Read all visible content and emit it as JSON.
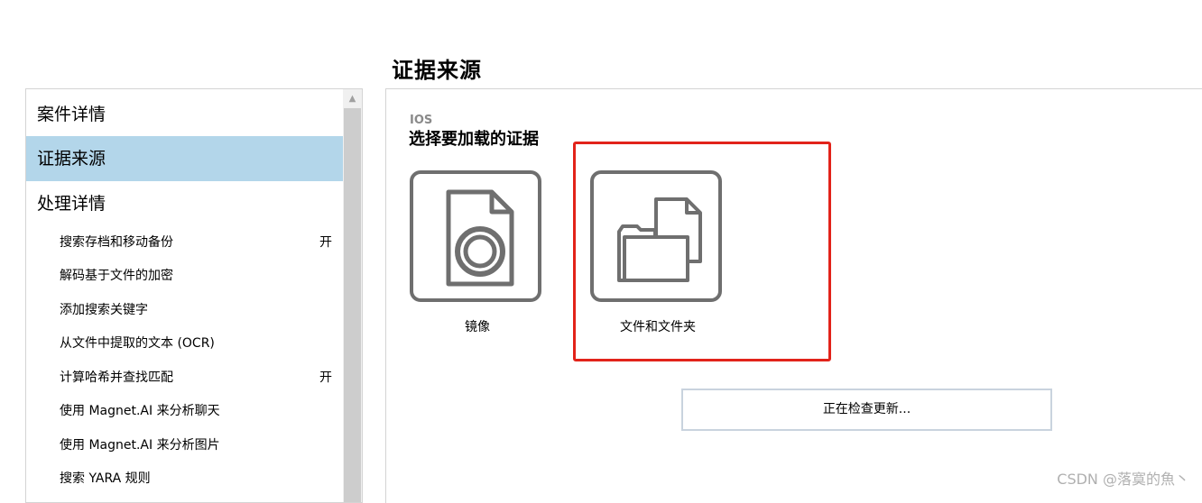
{
  "page": {
    "title": "证据来源"
  },
  "nav": {
    "items": [
      {
        "label": "案件详情"
      },
      {
        "label": "证据来源"
      },
      {
        "label": "处理详情"
      }
    ],
    "sub_items": [
      {
        "label": "搜索存档和移动备份",
        "state": "开"
      },
      {
        "label": "解码基于文件的加密",
        "state": ""
      },
      {
        "label": "添加搜索关键字",
        "state": ""
      },
      {
        "label": "从文件中提取的文本 (OCR)",
        "state": ""
      },
      {
        "label": "计算哈希并查找匹配",
        "state": "开"
      },
      {
        "label": "使用 Magnet.AI 来分析聊天",
        "state": ""
      },
      {
        "label": "使用 Magnet.AI 来分析图片",
        "state": ""
      },
      {
        "label": "搜索 YARA 规则",
        "state": ""
      }
    ]
  },
  "content": {
    "platform_label": "IOS",
    "section_title": "选择要加载的证据",
    "options": [
      {
        "label": "镜像",
        "icon": "disk-image-icon"
      },
      {
        "label": "文件和文件夹",
        "icon": "files-and-folders-icon"
      }
    ],
    "update_button_label": "正在检查更新..."
  },
  "watermark": "CSDN @落寞的魚丶",
  "colors": {
    "selected_nav": "#b3d6ea",
    "highlight_border": "#e2231a",
    "icon_gray": "#6f6f6f"
  }
}
